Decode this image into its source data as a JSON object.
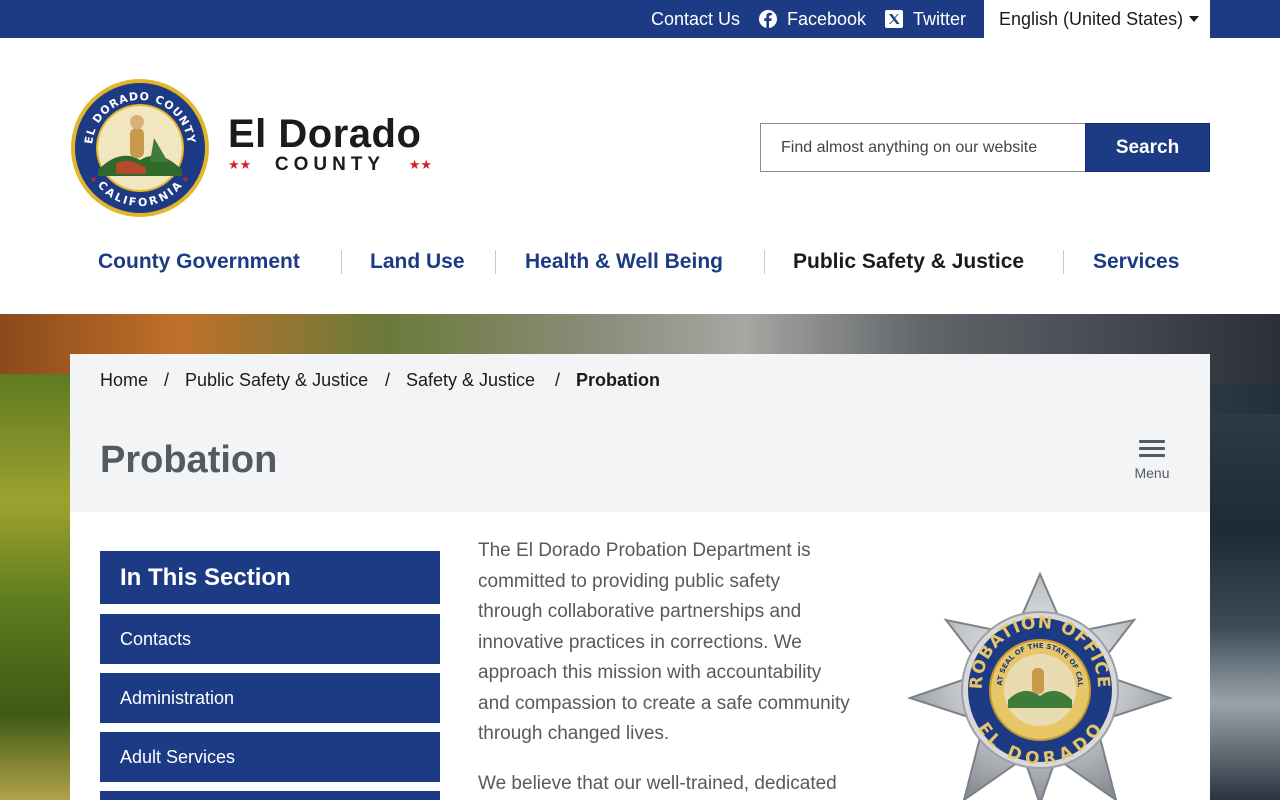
{
  "topbar": {
    "contact": "Contact Us",
    "facebook": "Facebook",
    "twitter": "Twitter",
    "language": "English (United States)"
  },
  "header": {
    "brand_name": "El Dorado",
    "brand_sub": "COUNTY",
    "brand_stars": "★★",
    "seal_text": [
      "EL DORADO COUNTY",
      "CALIFORNIA"
    ],
    "search_placeholder": "Find almost anything on our website",
    "search_button": "Search"
  },
  "nav": [
    {
      "label": "County Government"
    },
    {
      "label": "Land Use"
    },
    {
      "label": "Health & Well Being"
    },
    {
      "label": "Public Safety & Justice"
    },
    {
      "label": "Services"
    }
  ],
  "breadcrumb": {
    "items": [
      "Home",
      "Public Safety & Justice",
      "Safety & Justice",
      "Probation"
    ],
    "separator": "/"
  },
  "page": {
    "title": "Probation",
    "menu_label": "Menu"
  },
  "section": {
    "heading": "In This Section",
    "items": [
      "Contacts",
      "Administration",
      "Adult Services"
    ]
  },
  "body": {
    "para1_lines": [
      "The El Dorado Probation Department is",
      "committed to providing public safety",
      "through collaborative partnerships and",
      "innovative practices in corrections. We",
      "approach this mission with accountability",
      "and compassion to create a safe community",
      "through changed lives."
    ],
    "para2_lines": [
      "We believe that our well-trained, dedicated"
    ],
    "badge_text": {
      "outer": "PROBATION OFFICER",
      "inner": "THE GREAT SEAL OF THE STATE OF CALIFORNIA",
      "bottom": "EL DORADO"
    }
  },
  "colors": {
    "brand_blue": "#1d3a84",
    "heading_gray": "#555a60",
    "card_gray": "#f3f4f6",
    "star_red": "#d61f26"
  }
}
